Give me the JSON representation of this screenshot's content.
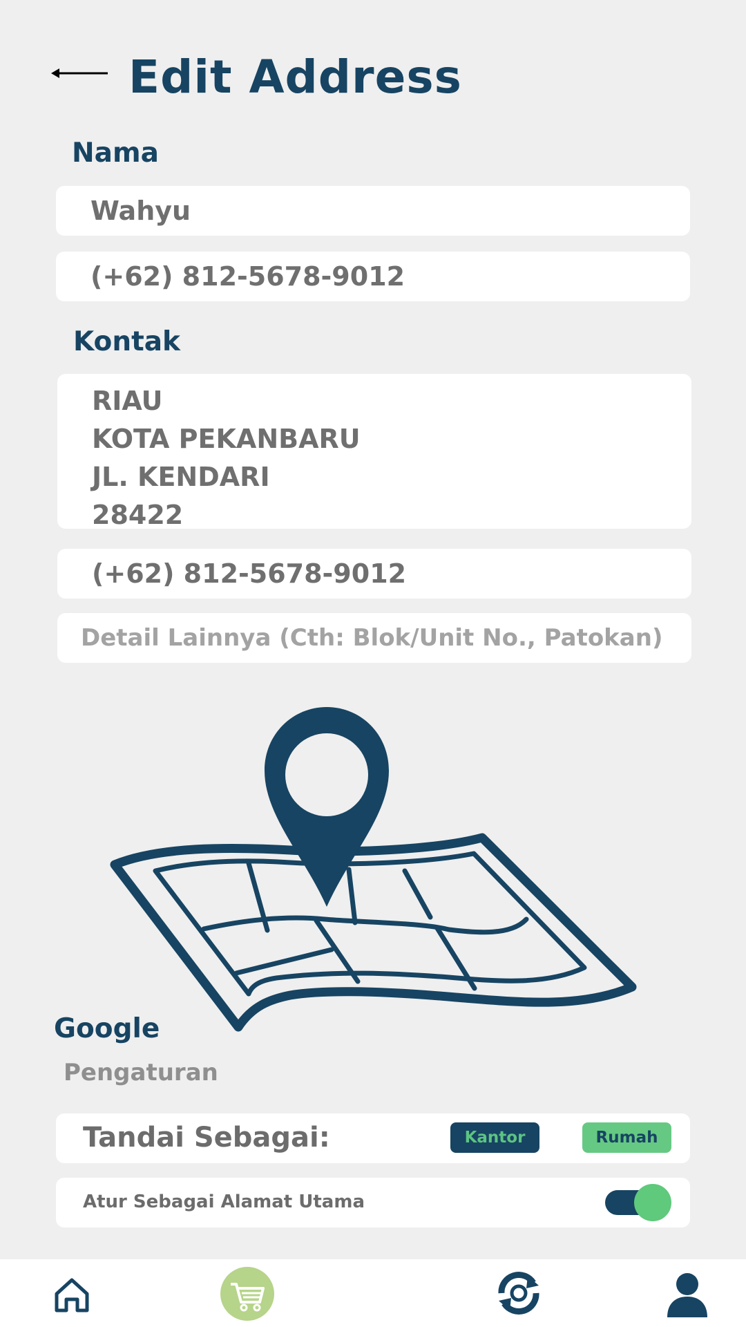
{
  "header": {
    "back_icon": "arrow-left-icon",
    "title": "Edit Address"
  },
  "nama": {
    "label": "Nama",
    "name_value": "Wahyu",
    "phone_value": "(+62) 812-5678-9012"
  },
  "kontak": {
    "label": "Kontak",
    "address_lines": [
      "RIAU",
      "KOTA PEKANBARU",
      "JL. KENDARI",
      "28422"
    ],
    "phone_value": "(+62) 812-5678-9012",
    "detail_placeholder": "Detail Lainnya (Cth: Blok/Unit No., Patokan)"
  },
  "map": {
    "icon": "map-pin-icon"
  },
  "google_label": "Google",
  "settings": {
    "label": "Pengaturan",
    "tag_title": "Tandai Sebagai:",
    "tag_kantor": "Kantor",
    "tag_rumah": "Rumah",
    "main_address_label": "Atur Sebagai Alamat Utama",
    "main_address_on": true
  },
  "nav": {
    "items": [
      "home-icon",
      "cart-icon",
      "sync-icon",
      "user-icon"
    ]
  },
  "colors": {
    "primary": "#174462",
    "accent_green": "#66c983",
    "background": "#efefef"
  }
}
